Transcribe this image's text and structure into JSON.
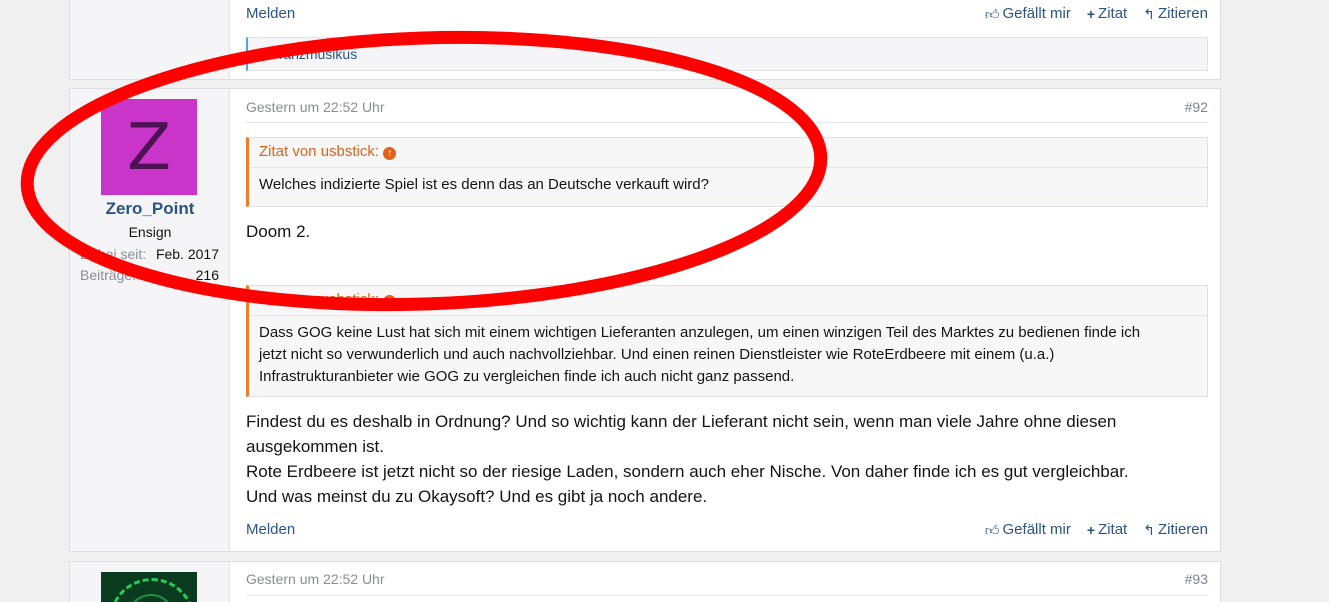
{
  "prev_post": {
    "report_label": "Melden",
    "like_label": "Gefällt mir",
    "quote_label": "Zitat",
    "reply_label": "Zitieren",
    "liked_by": "Tanzmusikus"
  },
  "post92": {
    "date": "Gestern um 22:52 Uhr",
    "number": "#92",
    "author": {
      "avatar_letter": "Z",
      "avatar_color": "#c934c9",
      "name": "Zero_Point",
      "title": "Ensign",
      "joined_label": "Dabei seit:",
      "joined_value": "Feb. 2017",
      "posts_label": "Beiträge:",
      "posts_value": "216"
    },
    "quote1": {
      "head": "Zitat von usbstick:",
      "text": "Welches indizierte Spiel ist es denn das an Deutsche verkauft wird?"
    },
    "reply1": "Doom 2.",
    "quote2": {
      "head": "Zitat von usbstick:",
      "line1": "Dass GOG keine Lust hat sich mit einem wichtigen Lieferanten anzulegen, um einen winzigen Teil des Marktes zu bedienen finde ich",
      "line2": "jetzt nicht so verwunderlich und auch nachvollziehbar. Und einen reinen Dienstleister wie RoteErdbeere mit einem (u.a.)",
      "line3": "Infrastrukturanbieter wie GOG zu vergleichen finde ich auch nicht ganz passend."
    },
    "reply2": {
      "line1": "Findest du es deshalb in Ordnung? Und so wichtig kann der Lieferant nicht sein, wenn man viele Jahre ohne diesen",
      "line2": "ausgekommen ist.",
      "line3": "Rote Erdbeere ist jetzt nicht so der riesige Laden, sondern auch eher Nische. Von daher finde ich es gut vergleichbar.",
      "line4": "Und was meinst du zu Okaysoft? Und es gibt ja noch andere."
    },
    "report_label": "Melden",
    "like_label": "Gefällt mir",
    "quote_label": "Zitat",
    "reply_label": "Zitieren"
  },
  "post93": {
    "date": "Gestern um 22:52 Uhr",
    "number": "#93"
  },
  "colors": {
    "link": "#2b5485",
    "quote_accent": "#f27d28",
    "annotation_ellipse": "#ff0000"
  },
  "icons": {
    "like": "thumbs-up-icon",
    "quote": "plus-icon",
    "reply": "reply-arrow-icon",
    "quote_jump": "circle-arrow-up-icon"
  }
}
